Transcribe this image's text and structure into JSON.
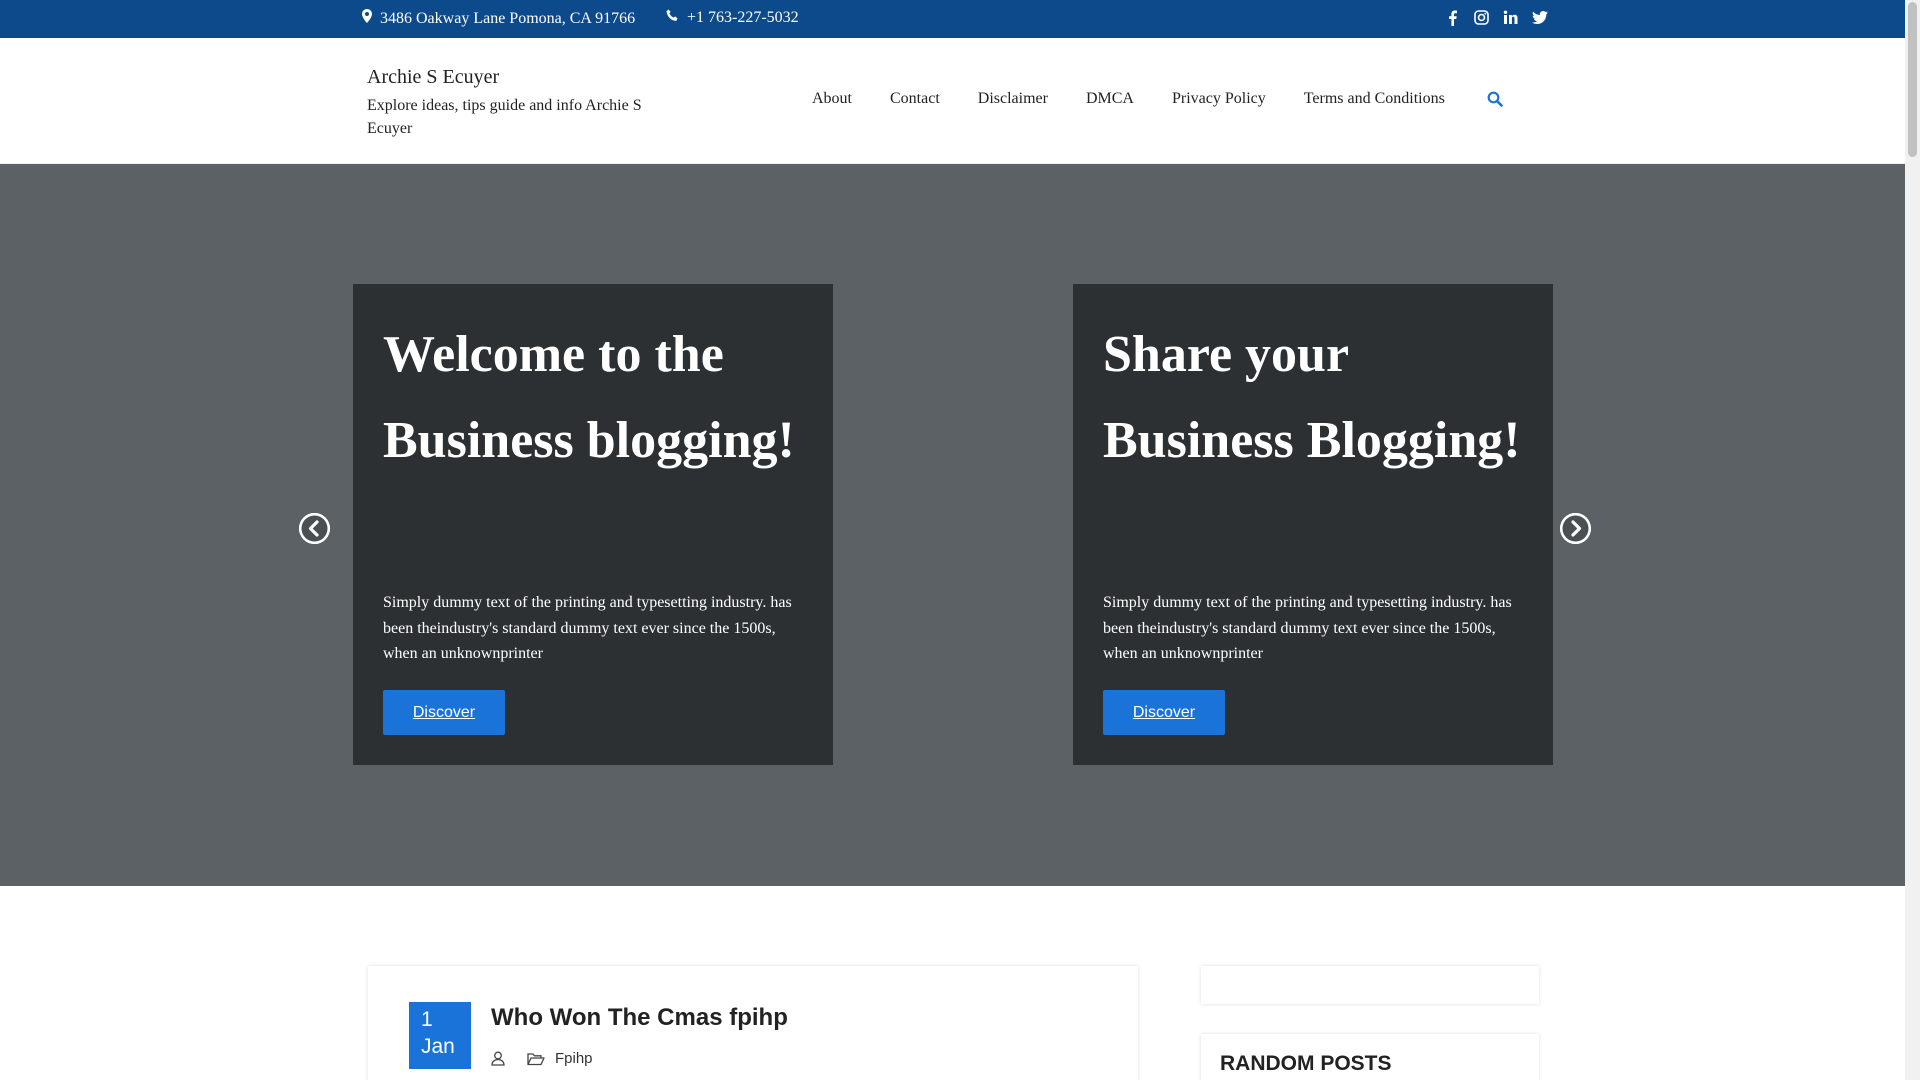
{
  "topbar": {
    "address": "3486 Oakway Lane Pomona, CA 91766",
    "phone": "+1 763-227-5032",
    "social_icons": [
      "facebook-icon",
      "instagram-icon",
      "linkedin-icon",
      "twitter-icon"
    ]
  },
  "header": {
    "site_title": "Archie S Ecuyer",
    "site_description": "Explore ideas, tips guide and info Archie S Ecuyer",
    "nav": [
      "About",
      "Contact",
      "Disclaimer",
      "DMCA",
      "Privacy Policy",
      "Terms and Conditions"
    ]
  },
  "slider": {
    "slides": [
      {
        "title": "Welcome to the Business blogging!",
        "text": "Simply dummy text of the printing and typesetting industry. has been theindustry's standard dummy text ever since the 1500s, when an unknownprinter",
        "button": "Discover"
      },
      {
        "title": "Share your Business Blogging!",
        "text": "Simply dummy text of the printing and typesetting industry. has been theindustry's standard dummy text ever since the 1500s, when an unknownprinter",
        "button": "Discover"
      }
    ]
  },
  "post": {
    "day": "1",
    "month": "Jan",
    "title": "Who Won The Cmas fpihp",
    "category": "Fpihp"
  },
  "sidebar": {
    "random_posts_title": "RANDOM POSTS"
  },
  "colors": {
    "topbar": "#0d4a8c",
    "accent": "#1a73d8",
    "hero_bg": "#5b6165",
    "slide_bg": "#2d3033"
  }
}
